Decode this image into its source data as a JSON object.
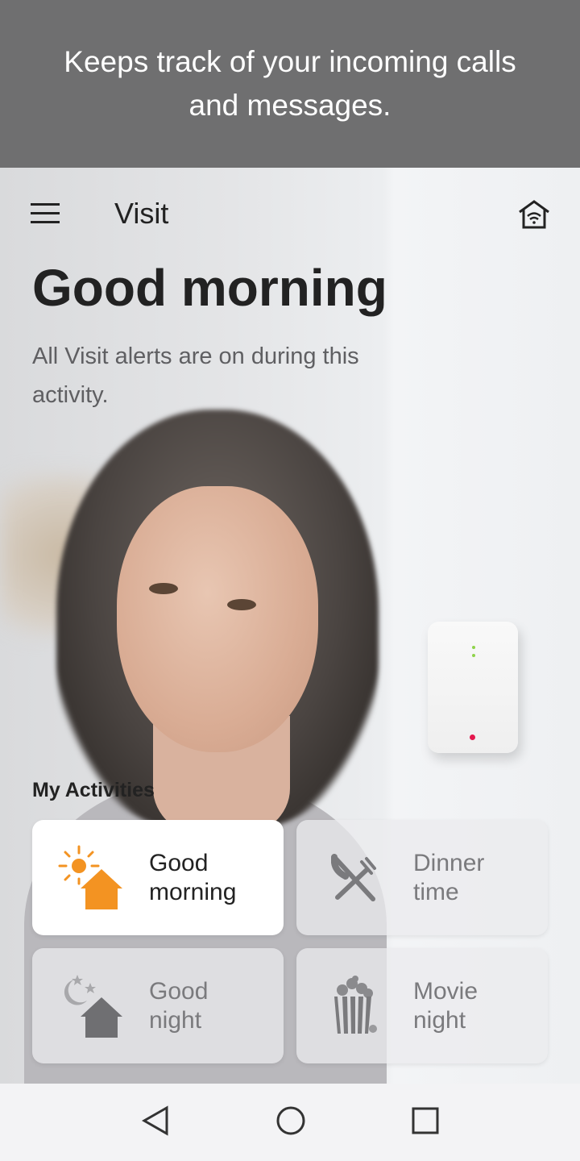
{
  "banner": {
    "text": "Keeps track of your incoming calls and messages."
  },
  "header": {
    "title": "Visit",
    "menu_icon": "hamburger-icon",
    "home_icon": "home-wifi-icon"
  },
  "main": {
    "greeting": "Good morning",
    "subtitle": "All Visit alerts are on during this activity.",
    "activities_label": "My Activities"
  },
  "activities": [
    {
      "label": "Good morning",
      "icon": "sun-house-icon",
      "selected": true
    },
    {
      "label": "Dinner time",
      "icon": "knife-fork-icon",
      "selected": false
    },
    {
      "label": "Good night",
      "icon": "moon-house-icon",
      "selected": false
    },
    {
      "label": "Movie night",
      "icon": "popcorn-icon",
      "selected": false
    }
  ],
  "colors": {
    "accent": "#f39322",
    "inactive_icon": "#7a7a7d",
    "banner": "#6f6f70"
  },
  "navbar": {
    "back": "back-triangle-icon",
    "home": "home-circle-icon",
    "recents": "recents-square-icon"
  }
}
